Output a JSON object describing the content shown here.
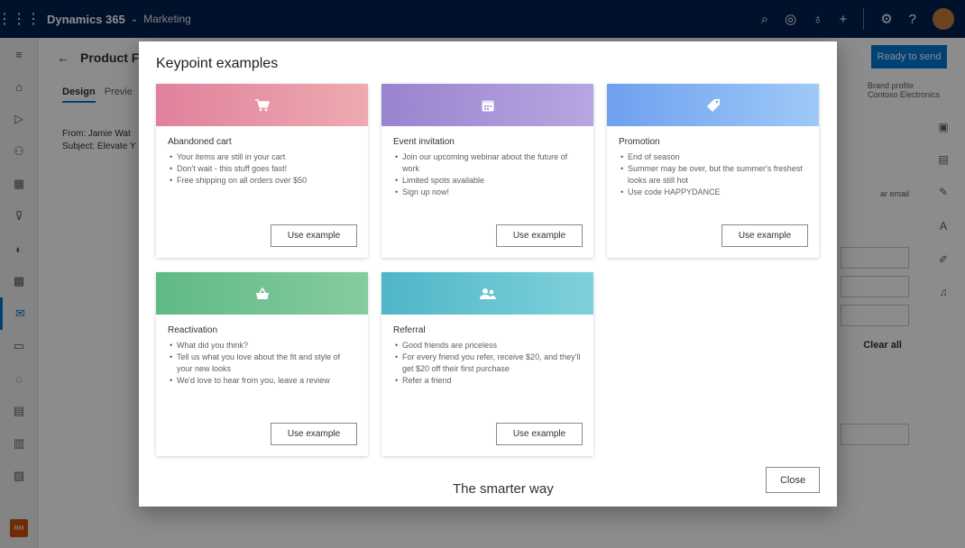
{
  "topbar": {
    "app_name": "Dynamics 365",
    "chevron": "⌄",
    "area": "Marketing",
    "icons": [
      "search-icon",
      "target-icon",
      "lightbulb-icon",
      "plus-icon",
      "settings-icon",
      "help-icon",
      "avatar"
    ]
  },
  "page": {
    "title": "Product F",
    "tabs": [
      "Design",
      "Previe"
    ],
    "from_label": "From: Jamie Wat",
    "subject_label": "Subject: Elevate Y",
    "ready_button": "Ready to send",
    "brand_label": "Brand profile",
    "brand_value": "Contoso Electronics",
    "side_text": "ar email",
    "clear_all": "Clear all",
    "body_text": "The smarter way",
    "user_initials": "RM"
  },
  "dialog": {
    "title": "Keypoint examples",
    "close_label": "Close",
    "cards": [
      {
        "title": "Abandoned cart",
        "icon": "cart-icon",
        "color_from": "#e0819c",
        "color_to": "#eeaab0",
        "items": [
          "Your items are still in your cart",
          "Don't wait - this stuff goes fast!",
          "Free shipping on all orders over $50"
        ],
        "button": "Use example"
      },
      {
        "title": "Event invitation",
        "icon": "calendar-icon",
        "color_from": "#9a83cf",
        "color_to": "#b7a6e0",
        "items": [
          "Join our upcoming webinar about the future of work",
          "Limited spots available",
          "Sign up now!"
        ],
        "button": "Use example"
      },
      {
        "title": "Promotion",
        "icon": "tag-icon",
        "color_from": "#6fa0ef",
        "color_to": "#9ec9f7",
        "items": [
          "End of season",
          "Summer may be over, but the summer's freshest looks are still hot",
          "Use code HAPPYDANCE"
        ],
        "button": "Use example"
      },
      {
        "title": "Reactivation",
        "icon": "basket-icon",
        "color_from": "#5fba86",
        "color_to": "#86cba0",
        "items": [
          "What did you think?",
          "Tell us what you love about the fit and style of your new looks",
          "We'd love to hear from you, leave a review"
        ],
        "button": "Use example"
      },
      {
        "title": "Referral",
        "icon": "people-icon",
        "color_from": "#4fb6c8",
        "color_to": "#7fd1db",
        "items": [
          "Good friends are priceless",
          "For every friend you refer, receive $20, and they'll get $20 off their first purchase",
          "Refer a friend"
        ],
        "button": "Use example"
      }
    ]
  }
}
